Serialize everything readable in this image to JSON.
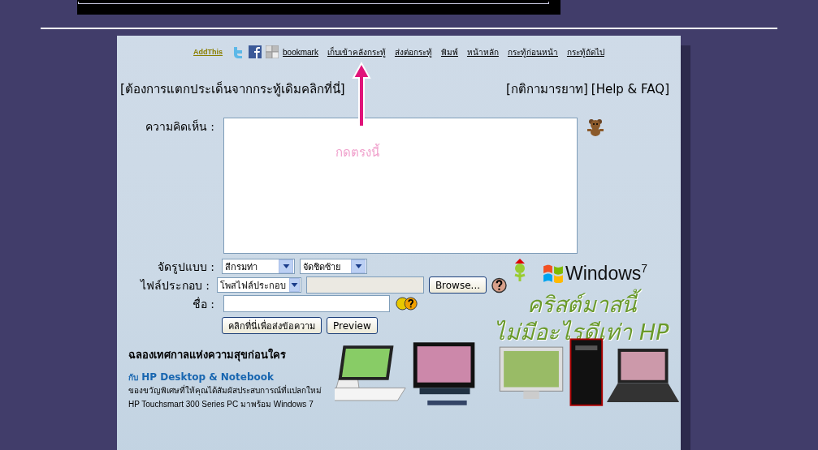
{
  "share": {
    "addthis": "AddThis"
  },
  "links": [
    {
      "label": "bookmark"
    },
    {
      "label": "เก็บเข้าคลังกระทู้"
    },
    {
      "label": "ส่งต่อกระทู้"
    },
    {
      "label": "พิมพ์"
    },
    {
      "label": "หน้าหลัก"
    },
    {
      "label": "กระทู้ก่อนหน้า"
    },
    {
      "label": "กระทู้ถัดไป"
    }
  ],
  "annotation": {
    "text": "กดตรงนี้"
  },
  "split_link": "[ต้องการแตกประเด็นจากกระทู้เดิมคลิกที่นี่]",
  "rules_link": "[กติกามารยาท]",
  "help_link": "[Help & FAQ]",
  "form": {
    "comment_label": "ความคิดเห็น :",
    "format_label": "จัดรูปแบบ :",
    "color_select": "สีกรมท่า",
    "align_select": "จัดชิดซ้าย",
    "file_label": "ไฟล์ประกอบ :",
    "file_type_select": "โพสไฟล์ประกอบ",
    "browse": "Browse...",
    "name_label": "ชื่อ :",
    "submit": "คลิกที่นี่เพื่อส่งข้อความ",
    "preview": "Preview"
  },
  "ad": {
    "logo": "Windows",
    "logo_version": "7",
    "title_line1": "คริสต์มาสนี้",
    "title_line2": "ไม่มีอะไรดีเท่า HP",
    "heading": "ฉลองเทศกาลแห่งความสุขก่อนใคร",
    "sub_prefix": "กับ",
    "sub": "HP Desktop & Notebook",
    "body_1": "ของขวัญพิเศษที่ให้คุณได้สัมผัสประสบการณ์ที่แปลกใหม่",
    "body_2": "HP Touchsmart 300 Series PC มาพร้อม Windows 7"
  }
}
